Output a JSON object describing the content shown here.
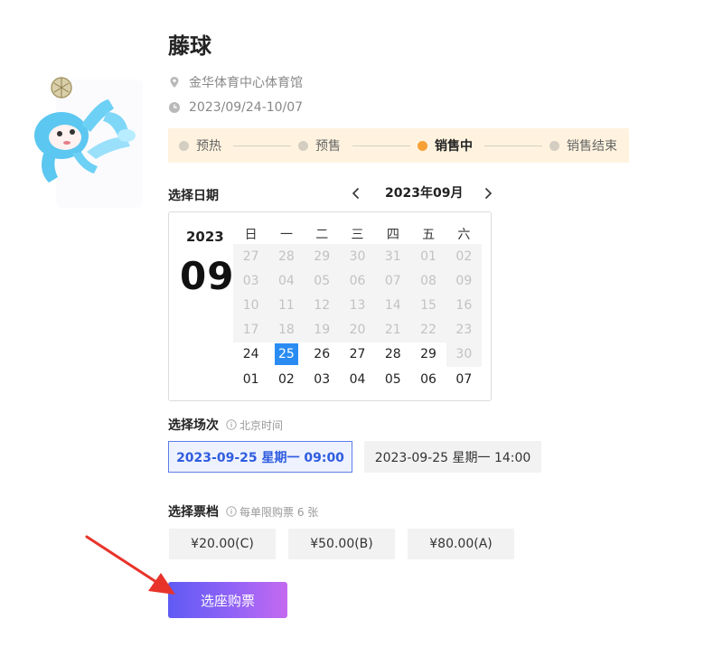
{
  "event": {
    "title": "藤球",
    "venue": "金华体育中心体育馆",
    "dates": "2023/09/24-10/07"
  },
  "progress": {
    "steps": [
      {
        "label": "预热",
        "state": "done"
      },
      {
        "label": "预售",
        "state": "done"
      },
      {
        "label": "销售中",
        "state": "active"
      },
      {
        "label": "销售结束",
        "state": "pending"
      }
    ],
    "active_color": "#f7a034",
    "background": "#fff3df"
  },
  "date_picker": {
    "label": "选择日期",
    "current_month": "2023年09月",
    "prev_icon": "chevron-left-icon",
    "next_icon": "chevron-right-icon",
    "year": "2023",
    "month": "09",
    "weekdays": [
      "日",
      "一",
      "二",
      "三",
      "四",
      "五",
      "六"
    ],
    "rows": [
      [
        {
          "d": "27",
          "s": "disabled"
        },
        {
          "d": "28",
          "s": "disabled"
        },
        {
          "d": "29",
          "s": "disabled"
        },
        {
          "d": "30",
          "s": "disabled"
        },
        {
          "d": "31",
          "s": "disabled"
        },
        {
          "d": "01",
          "s": "disabled"
        },
        {
          "d": "02",
          "s": "disabled"
        }
      ],
      [
        {
          "d": "03",
          "s": "disabled"
        },
        {
          "d": "04",
          "s": "disabled"
        },
        {
          "d": "05",
          "s": "disabled"
        },
        {
          "d": "06",
          "s": "disabled"
        },
        {
          "d": "07",
          "s": "disabled"
        },
        {
          "d": "08",
          "s": "disabled"
        },
        {
          "d": "09",
          "s": "disabled"
        }
      ],
      [
        {
          "d": "10",
          "s": "disabled"
        },
        {
          "d": "11",
          "s": "disabled"
        },
        {
          "d": "12",
          "s": "disabled"
        },
        {
          "d": "13",
          "s": "disabled"
        },
        {
          "d": "14",
          "s": "disabled"
        },
        {
          "d": "15",
          "s": "disabled"
        },
        {
          "d": "16",
          "s": "disabled"
        }
      ],
      [
        {
          "d": "17",
          "s": "disabled"
        },
        {
          "d": "18",
          "s": "disabled"
        },
        {
          "d": "19",
          "s": "disabled"
        },
        {
          "d": "20",
          "s": "disabled"
        },
        {
          "d": "21",
          "s": "disabled"
        },
        {
          "d": "22",
          "s": "disabled"
        },
        {
          "d": "23",
          "s": "disabled"
        }
      ],
      [
        {
          "d": "24",
          "s": "enabled"
        },
        {
          "d": "25",
          "s": "selected"
        },
        {
          "d": "26",
          "s": "enabled"
        },
        {
          "d": "27",
          "s": "enabled"
        },
        {
          "d": "28",
          "s": "enabled"
        },
        {
          "d": "29",
          "s": "enabled"
        },
        {
          "d": "30",
          "s": "disabled"
        }
      ],
      [
        {
          "d": "01",
          "s": "enabled"
        },
        {
          "d": "02",
          "s": "enabled"
        },
        {
          "d": "03",
          "s": "enabled"
        },
        {
          "d": "04",
          "s": "enabled"
        },
        {
          "d": "05",
          "s": "enabled"
        },
        {
          "d": "06",
          "s": "enabled"
        },
        {
          "d": "07",
          "s": "enabled"
        }
      ]
    ],
    "selected_color": "#2a8cf3"
  },
  "session": {
    "label": "选择场次",
    "hint": "北京时间",
    "options": [
      {
        "text": "2023-09-25 星期一 09:00",
        "selected": true
      },
      {
        "text": "2023-09-25 星期一 14:00",
        "selected": false
      }
    ]
  },
  "tiers": {
    "label": "选择票档",
    "hint": "每单限购票 6 张",
    "options": [
      "¥20.00(C)",
      "¥50.00(B)",
      "¥80.00(A)"
    ]
  },
  "buy_button": {
    "label": "选座购票",
    "gradient": [
      "#5f5bf4",
      "#c569f0"
    ]
  },
  "annotation": {
    "arrow_color": "#e8332a"
  }
}
